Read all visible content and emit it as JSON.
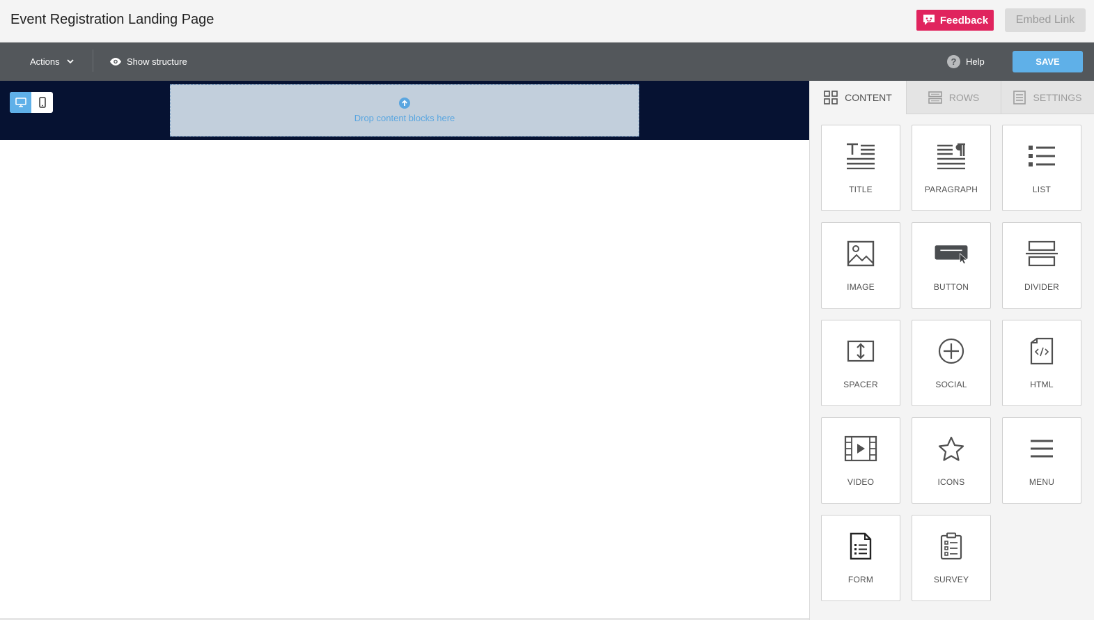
{
  "header": {
    "title": "Event Registration Landing Page",
    "feedback_label": "Feedback",
    "embed_label": "Embed Link"
  },
  "toolbar": {
    "actions_label": "Actions",
    "show_structure_label": "Show structure",
    "help_label": "Help",
    "save_label": "SAVE"
  },
  "canvas": {
    "row_background": "#061232",
    "dropzone_text": "Drop content blocks here"
  },
  "sidebar": {
    "tabs": [
      {
        "label": "CONTENT",
        "icon": "grid-icon",
        "active": true
      },
      {
        "label": "ROWS",
        "icon": "rows-icon",
        "active": false
      },
      {
        "label": "SETTINGS",
        "icon": "settings-doc-icon",
        "active": false
      }
    ],
    "blocks": [
      {
        "label": "TITLE",
        "icon": "title-icon"
      },
      {
        "label": "PARAGRAPH",
        "icon": "paragraph-icon"
      },
      {
        "label": "LIST",
        "icon": "list-icon"
      },
      {
        "label": "IMAGE",
        "icon": "image-icon"
      },
      {
        "label": "BUTTON",
        "icon": "button-icon"
      },
      {
        "label": "DIVIDER",
        "icon": "divider-icon"
      },
      {
        "label": "SPACER",
        "icon": "spacer-icon"
      },
      {
        "label": "SOCIAL",
        "icon": "social-icon"
      },
      {
        "label": "HTML",
        "icon": "html-icon"
      },
      {
        "label": "VIDEO",
        "icon": "video-icon"
      },
      {
        "label": "ICONS",
        "icon": "star-icon"
      },
      {
        "label": "MENU",
        "icon": "menu-icon"
      },
      {
        "label": "FORM",
        "icon": "form-icon"
      },
      {
        "label": "SURVEY",
        "icon": "survey-icon"
      }
    ]
  },
  "colors": {
    "accent": "#5fb0e8",
    "feedback": "#e0245e",
    "toolbar": "#53575b"
  }
}
